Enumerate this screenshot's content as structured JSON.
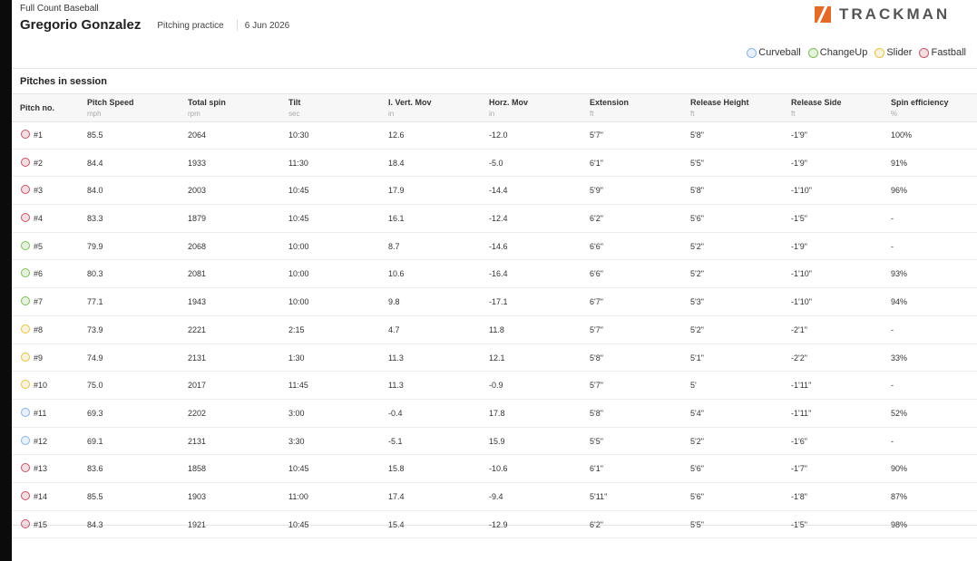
{
  "app": {
    "name": "Full Count Baseball",
    "player": "Gregorio Gonzalez",
    "session_type": "Pitching practice",
    "date": "6 Jun 2026"
  },
  "brand": {
    "logo_text": "TRACKMAN",
    "accent": "#e36b2a"
  },
  "legend": [
    {
      "label": "Curveball",
      "color": "#8ab4e8"
    },
    {
      "label": "ChangeUp",
      "color": "#7fbf5a"
    },
    {
      "label": "Slider",
      "color": "#e6c24a"
    },
    {
      "label": "Fastball",
      "color": "#c2566a"
    }
  ],
  "panel": {
    "title": "Pitches in session"
  },
  "columns": [
    {
      "label": "Pitch no.",
      "unit": ""
    },
    {
      "label": "Pitch Speed",
      "unit": "mph"
    },
    {
      "label": "Total spin",
      "unit": "rpm"
    },
    {
      "label": "Tilt",
      "unit": "sec"
    },
    {
      "label": "I. Vert. Mov",
      "unit": "in"
    },
    {
      "label": "Horz. Mov",
      "unit": "in"
    },
    {
      "label": "Extension",
      "unit": "ft"
    },
    {
      "label": "Release Height",
      "unit": "ft"
    },
    {
      "label": "Release Side",
      "unit": "ft"
    },
    {
      "label": "Spin efficiency",
      "unit": "%"
    }
  ],
  "rows": [
    {
      "type": "Fastball",
      "color": "#c2566a",
      "cells": [
        "#1",
        "85.5",
        "2064",
        "10:30",
        "12.6",
        "-12.0",
        "5'7\"",
        "5'8\"",
        "-1'9\"",
        "100%"
      ]
    },
    {
      "type": "Fastball",
      "color": "#c2566a",
      "cells": [
        "#2",
        "84.4",
        "1933",
        "11:30",
        "18.4",
        "-5.0",
        "6'1\"",
        "5'5\"",
        "-1'9\"",
        "91%"
      ]
    },
    {
      "type": "Fastball",
      "color": "#c2566a",
      "cells": [
        "#3",
        "84.0",
        "2003",
        "10:45",
        "17.9",
        "-14.4",
        "5'9\"",
        "5'8\"",
        "-1'10\"",
        "96%"
      ]
    },
    {
      "type": "Fastball",
      "color": "#c2566a",
      "cells": [
        "#4",
        "83.3",
        "1879",
        "10:45",
        "16.1",
        "-12.4",
        "6'2\"",
        "5'6\"",
        "-1'5\"",
        "-"
      ]
    },
    {
      "type": "ChangeUp",
      "color": "#7fbf5a",
      "cells": [
        "#5",
        "79.9",
        "2068",
        "10:00",
        "8.7",
        "-14.6",
        "6'6\"",
        "5'2\"",
        "-1'9\"",
        "-"
      ]
    },
    {
      "type": "ChangeUp",
      "color": "#7fbf5a",
      "cells": [
        "#6",
        "80.3",
        "2081",
        "10:00",
        "10.6",
        "-16.4",
        "6'6\"",
        "5'2\"",
        "-1'10\"",
        "93%"
      ]
    },
    {
      "type": "ChangeUp",
      "color": "#7fbf5a",
      "cells": [
        "#7",
        "77.1",
        "1943",
        "10:00",
        "9.8",
        "-17.1",
        "6'7\"",
        "5'3\"",
        "-1'10\"",
        "94%"
      ]
    },
    {
      "type": "Slider",
      "color": "#e6c24a",
      "cells": [
        "#8",
        "73.9",
        "2221",
        "2:15",
        "4.7",
        "11.8",
        "5'7\"",
        "5'2\"",
        "-2'1\"",
        "-"
      ]
    },
    {
      "type": "Slider",
      "color": "#e6c24a",
      "cells": [
        "#9",
        "74.9",
        "2131",
        "1:30",
        "11.3",
        "12.1",
        "5'8\"",
        "5'1\"",
        "-2'2\"",
        "33%"
      ]
    },
    {
      "type": "Slider",
      "color": "#e6c24a",
      "cells": [
        "#10",
        "75.0",
        "2017",
        "11:45",
        "11.3",
        "-0.9",
        "5'7\"",
        "5'",
        "-1'11\"",
        "-"
      ]
    },
    {
      "type": "Curveball",
      "color": "#8ab4e8",
      "cells": [
        "#11",
        "69.3",
        "2202",
        "3:00",
        "-0.4",
        "17.8",
        "5'8\"",
        "5'4\"",
        "-1'11\"",
        "52%"
      ]
    },
    {
      "type": "Curveball",
      "color": "#8ab4e8",
      "cells": [
        "#12",
        "69.1",
        "2131",
        "3:30",
        "-5.1",
        "15.9",
        "5'5\"",
        "5'2\"",
        "-1'6\"",
        "-"
      ]
    },
    {
      "type": "Fastball",
      "color": "#c2566a",
      "cells": [
        "#13",
        "83.6",
        "1858",
        "10:45",
        "15.8",
        "-10.6",
        "6'1\"",
        "5'6\"",
        "-1'7\"",
        "90%"
      ]
    },
    {
      "type": "Fastball",
      "color": "#c2566a",
      "cells": [
        "#14",
        "85.5",
        "1903",
        "11:00",
        "17.4",
        "-9.4",
        "5'11\"",
        "5'6\"",
        "-1'8\"",
        "87%"
      ]
    },
    {
      "type": "Fastball",
      "color": "#c2566a",
      "cells": [
        "#15",
        "84.3",
        "1921",
        "10:45",
        "15.4",
        "-12.9",
        "6'2\"",
        "5'5\"",
        "-1'5\"",
        "98%"
      ]
    }
  ]
}
